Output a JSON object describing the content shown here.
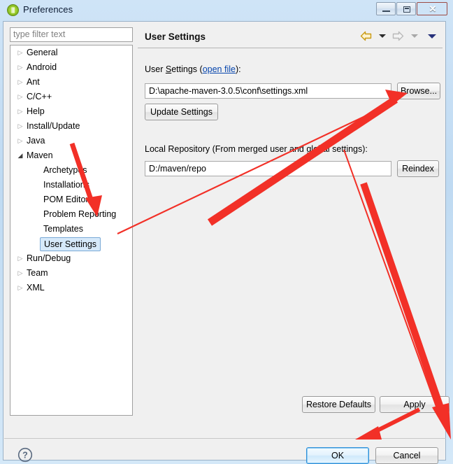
{
  "window": {
    "title": "Preferences",
    "icon": "eclipse-icon",
    "controls": {
      "minimize": "minimize-button",
      "maximize": "restore-button",
      "close": "✕"
    }
  },
  "colors": {
    "accent_blue": "#2f8fd8",
    "link_blue": "#0645ad",
    "selection_blue": "#d6e9fa",
    "annotation_red": "#f23027",
    "panel_gray": "#f0f0f0",
    "title_gradient_top": "#cfe4f7",
    "close_red": "#c6342a"
  },
  "filter": {
    "placeholder": "type filter text",
    "value": ""
  },
  "tree": {
    "items": [
      {
        "label": "General",
        "level": 1,
        "twisty": "collapsed",
        "selected": false
      },
      {
        "label": "Android",
        "level": 1,
        "twisty": "collapsed",
        "selected": false
      },
      {
        "label": "Ant",
        "level": 1,
        "twisty": "collapsed",
        "selected": false
      },
      {
        "label": "C/C++",
        "level": 1,
        "twisty": "collapsed",
        "selected": false
      },
      {
        "label": "Help",
        "level": 1,
        "twisty": "collapsed",
        "selected": false
      },
      {
        "label": "Install/Update",
        "level": 1,
        "twisty": "collapsed",
        "selected": false
      },
      {
        "label": "Java",
        "level": 1,
        "twisty": "collapsed",
        "selected": false
      },
      {
        "label": "Maven",
        "level": 1,
        "twisty": "expanded",
        "selected": false
      },
      {
        "label": "Archetypes",
        "level": 2,
        "twisty": "none",
        "selected": false
      },
      {
        "label": "Installations",
        "level": 2,
        "twisty": "none",
        "selected": false
      },
      {
        "label": "POM Editor",
        "level": 2,
        "twisty": "none",
        "selected": false
      },
      {
        "label": "Problem Reporting",
        "level": 2,
        "twisty": "none",
        "selected": false
      },
      {
        "label": "Templates",
        "level": 2,
        "twisty": "none",
        "selected": false
      },
      {
        "label": "User Settings",
        "level": 2,
        "twisty": "none",
        "selected": true
      },
      {
        "label": "Run/Debug",
        "level": 1,
        "twisty": "collapsed",
        "selected": false
      },
      {
        "label": "Team",
        "level": 1,
        "twisty": "collapsed",
        "selected": false
      },
      {
        "label": "XML",
        "level": 1,
        "twisty": "collapsed",
        "selected": false
      }
    ],
    "twisty_collapsed_glyph": "▷",
    "twisty_expanded_glyph": "◢"
  },
  "page": {
    "title": "User Settings",
    "nav": {
      "back_icon": "back-arrow-icon",
      "back_menu_icon": "chevron-down-icon",
      "forward_icon": "forward-arrow-icon",
      "forward_menu_icon": "chevron-down-icon",
      "menu_icon": "chevron-down-icon"
    },
    "user_settings": {
      "label_before": "User ",
      "label_mnemonic": "S",
      "label_after": "ettings (",
      "link": "open file",
      "label_end": "):",
      "value": "D:\\apache-maven-3.0.5\\conf\\settings.xml",
      "browse_button": "Browse...",
      "update_button": "Update Settings"
    },
    "local_repository": {
      "label": "Local Repository (From merged user and global settings):",
      "value": "D:/maven/repo",
      "reindex_button": "Reindex"
    },
    "restore_defaults_button": "Restore Defaults",
    "apply_button": "Apply"
  },
  "footer": {
    "help_icon": "help-question-icon",
    "ok_button": "OK",
    "cancel_button": "Cancel"
  },
  "annotations": {
    "arrow_to_browse": "arrow pointing up-right to Browse button",
    "arrow_to_problem_reporting": "arrow pointing down to Problem Reporting",
    "arrow_to_bottom_right": "arrow pointing down-right off the dialog",
    "arrow_to_ok": "arrow pointing left to OK button"
  }
}
